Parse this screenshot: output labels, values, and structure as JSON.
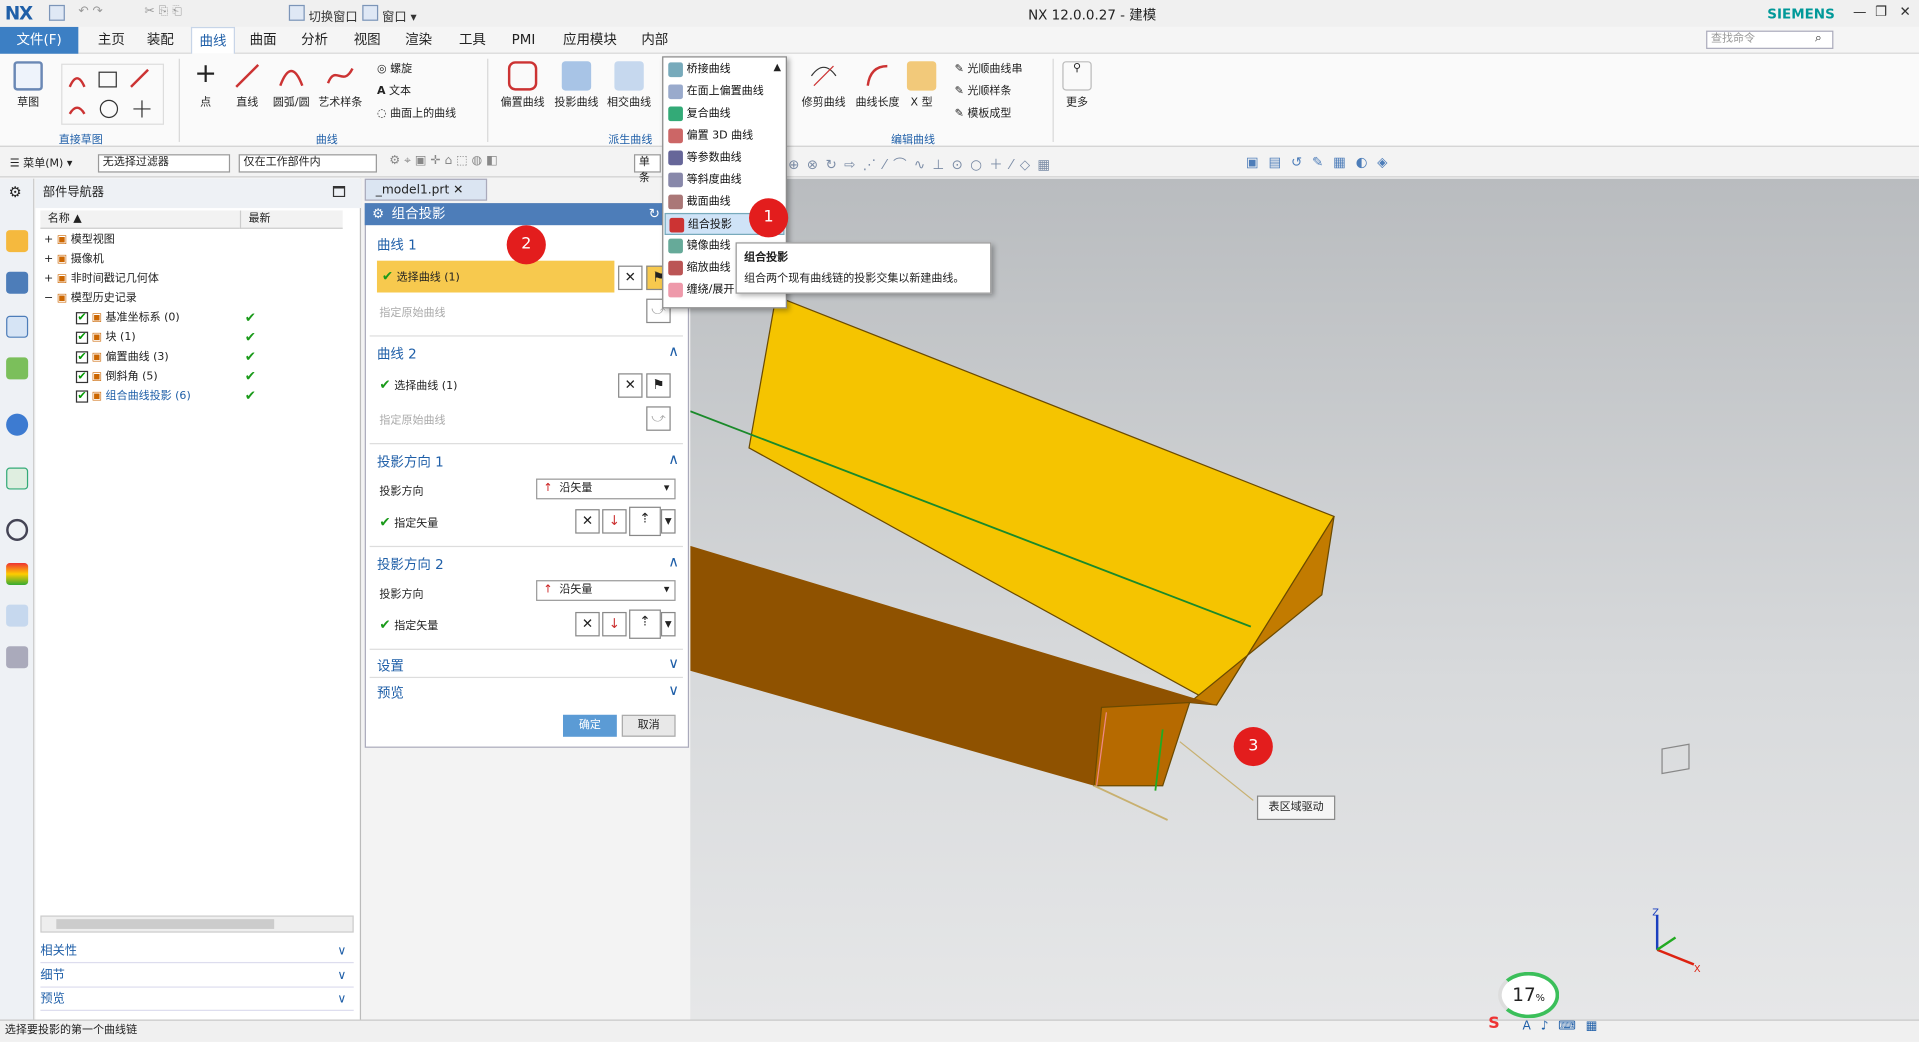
{
  "title": {
    "app": "NX",
    "caption": "NX 12.0.0.27 - 建模",
    "brand": "SIEMENS",
    "qa_switch_window": "切换窗口",
    "qa_window": "窗口"
  },
  "menu_tabs": [
    "文件(F)",
    "主页",
    "装配",
    "曲线",
    "曲面",
    "分析",
    "视图",
    "渲染",
    "工具",
    "PMI",
    "应用模块",
    "内部"
  ],
  "search_placeholder": "查找命令",
  "ribbon": {
    "sketch": "草图",
    "group_direct_sketch": "直接草图",
    "point": "点",
    "line": "直线",
    "arc": "圆弧/圆",
    "artspline": "艺术样条",
    "helix": "螺旋",
    "text": "文本",
    "curve_on_surface": "曲面上的曲线",
    "group_curve": "曲线",
    "offset": "偏置曲线",
    "project": "投影曲线",
    "intersect": "相交曲线",
    "group_derived": "派生曲线",
    "trim": "修剪曲线",
    "length": "曲线长度",
    "xform": "X 型",
    "smooth_string": "光顺曲线串",
    "smooth_spline": "光顺样条",
    "template": "模板成型",
    "group_edit": "编辑曲线",
    "more": "更多"
  },
  "toolbar2": {
    "menu": "菜单(M)",
    "filter": "无选择过滤器",
    "scope": "仅在工作部件内",
    "single": "单条"
  },
  "navigator": {
    "title": "部件导航器",
    "col_name": "名称",
    "col_latest": "最新",
    "rows": [
      {
        "label": "模型视图",
        "indent": 0,
        "check": false,
        "latest": false
      },
      {
        "label": "摄像机",
        "indent": 0,
        "check": false,
        "latest": false
      },
      {
        "label": "非时间戳记几何体",
        "indent": 0,
        "check": false,
        "latest": false
      },
      {
        "label": "模型历史记录",
        "indent": 0,
        "check": false,
        "latest": false
      },
      {
        "label": "基准坐标系 (0)",
        "indent": 1,
        "check": true,
        "latest": true
      },
      {
        "label": "块 (1)",
        "indent": 1,
        "check": true,
        "latest": true
      },
      {
        "label": "偏置曲线 (3)",
        "indent": 1,
        "check": true,
        "latest": true
      },
      {
        "label": "倒斜角 (5)",
        "indent": 1,
        "check": true,
        "latest": true
      },
      {
        "label": "组合曲线投影 (6)",
        "indent": 1,
        "check": true,
        "latest": true,
        "active": true
      }
    ],
    "sections": [
      "相关性",
      "细节",
      "预览"
    ]
  },
  "file_tab": "_model1.prt",
  "dialog": {
    "title": "组合投影",
    "curve1": "曲线 1",
    "select_curve": "选择曲线 (1)",
    "specify_original": "指定原始曲线",
    "curve2": "曲线 2",
    "dir1": "投影方向 1",
    "dir2": "投影方向 2",
    "proj_dir": "投影方向",
    "along_vector": "沿矢量",
    "specify_vector": "指定矢量",
    "settings": "设置",
    "preview": "预览",
    "ok": "确定",
    "cancel": "取消"
  },
  "dropdown": [
    "桥接曲线",
    "在面上偏置曲线",
    "复合曲线",
    "偏置 3D 曲线",
    "等参数曲线",
    "等斜度曲线",
    "截面曲线",
    "组合投影",
    "镜像曲线",
    "缩放曲线",
    "缠绕/展开"
  ],
  "tooltip": {
    "title": "组合投影",
    "desc": "组合两个现有曲线链的投影交集以新建曲线。"
  },
  "badges": [
    "1",
    "2",
    "3"
  ],
  "drive_label": "表区域驱动",
  "percent": "17",
  "status_text": "选择要投影的第一个曲线链",
  "colors": {
    "accent": "#1f5fa8",
    "face": "#f5c400",
    "side": "#b36a00",
    "badge": "#e31d1d"
  }
}
